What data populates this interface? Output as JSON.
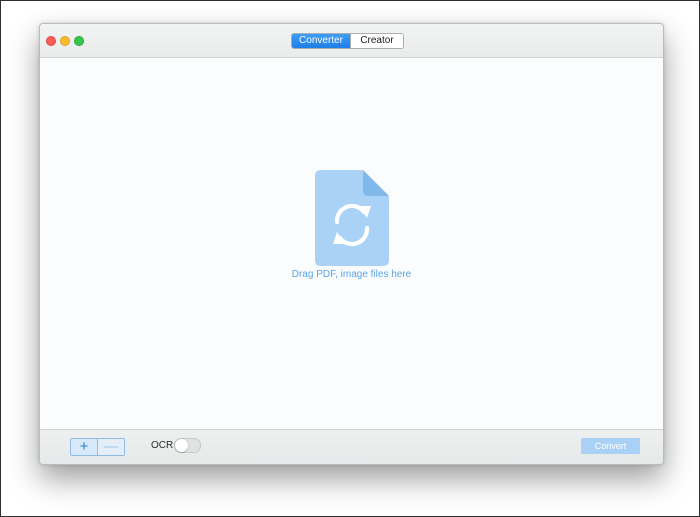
{
  "window": {
    "traffic_lights": [
      "close",
      "minimize",
      "maximize"
    ]
  },
  "tabs": [
    {
      "label": "Converter",
      "selected": true
    },
    {
      "label": "Creator",
      "selected": false
    }
  ],
  "dropzone": {
    "icon": "document-convert-icon",
    "label": "Drag PDF, image files here"
  },
  "toolbar": {
    "add_label": "+",
    "remove_label": "—",
    "ocr_label": "OCR",
    "ocr_enabled": false,
    "convert_label": "Convert",
    "convert_enabled": false
  },
  "colors": {
    "accent": "#1f7fe8",
    "icon_fill": "#a9d2f6",
    "label_blue": "#5aa5e6",
    "convert_disabled": "#a9d0f5"
  }
}
